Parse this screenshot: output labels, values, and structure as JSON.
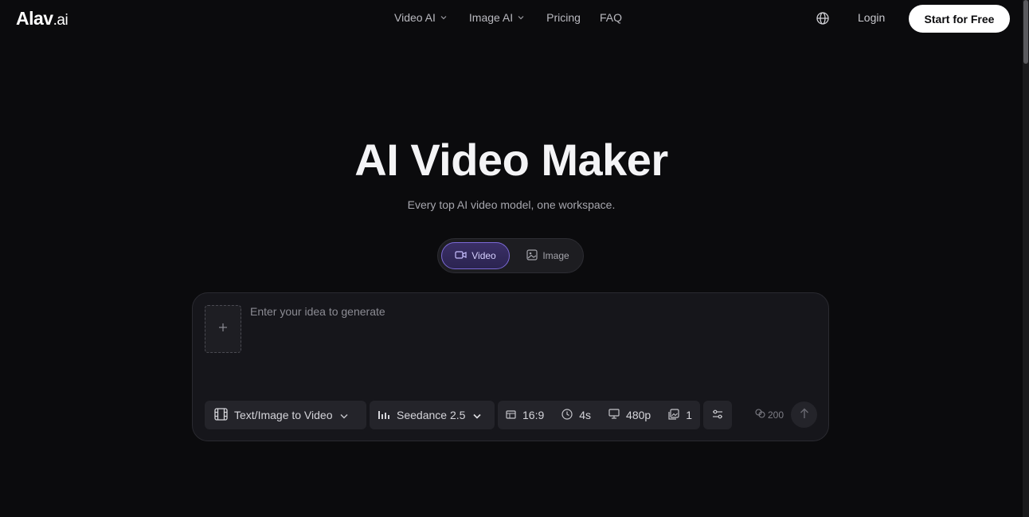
{
  "brand": {
    "name": "Alav",
    "suffix": ".ai"
  },
  "nav": {
    "items": [
      {
        "label": "Video AI",
        "has_dropdown": true
      },
      {
        "label": "Image AI",
        "has_dropdown": true
      },
      {
        "label": "Pricing",
        "has_dropdown": false
      },
      {
        "label": "FAQ",
        "has_dropdown": false
      }
    ],
    "language_icon": "globe-icon",
    "login": "Login",
    "cta": "Start for Free"
  },
  "hero": {
    "title": "AI Video Maker",
    "subtitle": "Every top AI video model, one workspace."
  },
  "mode_toggle": {
    "video": "Video",
    "image": "Image",
    "selected": "video"
  },
  "composer": {
    "placeholder": "Enter your idea to generate",
    "value": "",
    "upload_icon": "plus-icon",
    "mode": "Text/Image to Video",
    "model": "Seedance 2.5",
    "aspect_ratio": "16:9",
    "duration": "4s",
    "resolution": "480p",
    "count": "1",
    "credits": "200"
  },
  "colors": {
    "background": "#0b0b0d",
    "accent": "#7b69d6",
    "cta_bg": "#ffffff",
    "panel": "#16161b"
  }
}
